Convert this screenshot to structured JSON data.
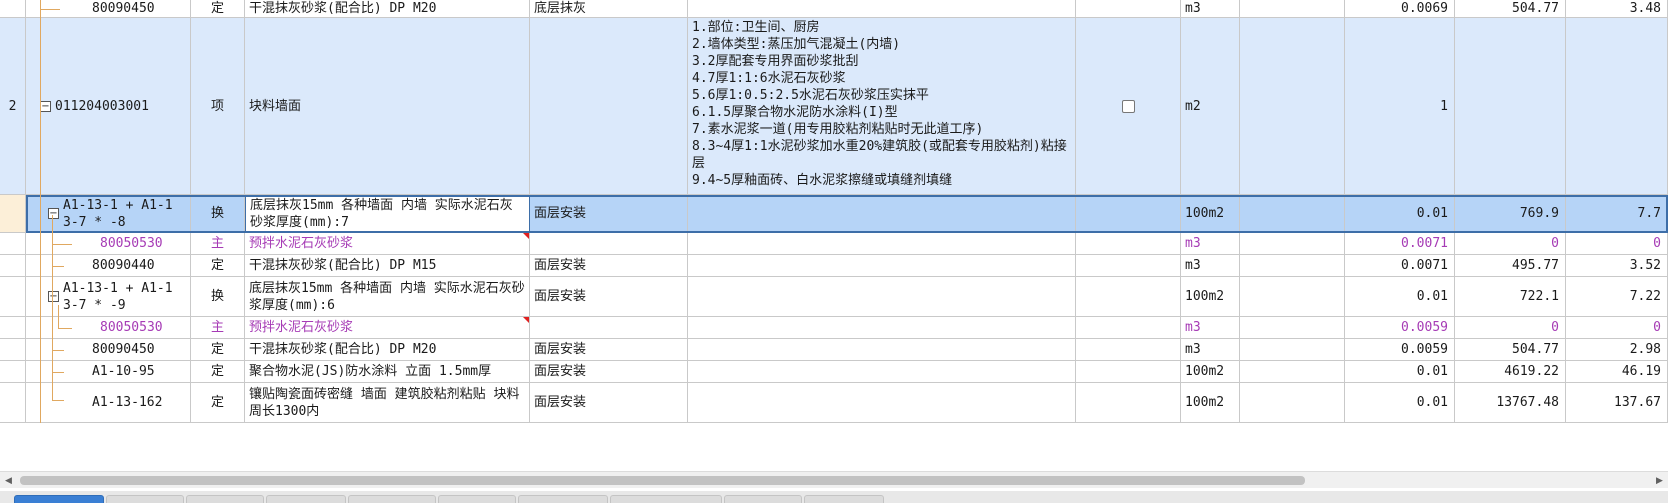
{
  "rows": [
    {
      "code": "80090450",
      "type": "定",
      "name": "干混抹灰砂浆(配合比) DP M20",
      "feature": "底层抹灰",
      "unit": "m3",
      "qty": "0.0069",
      "price": "504.77",
      "total": "3.48"
    },
    {
      "idx": "2",
      "code": "011204003001",
      "type": "项",
      "name": "块料墙面",
      "unit": "m2",
      "qty": "1",
      "desc": [
        "1.部位:卫生间、厨房",
        "2.墙体类型:蒸压加气混凝土(内墙)",
        "3.2厚配套专用界面砂浆批刮",
        "4.7厚1:1:6水泥石灰砂浆",
        "5.6厚1:0.5:2.5水泥石灰砂浆压实抹平",
        "6.1.5厚聚合物水泥防水涂料(I)型",
        "7.素水泥浆一道(用专用胶粘剂粘贴时无此道工序)",
        "8.3~4厚1:1水泥砂浆加水重20%建筑胶(或配套专用胶粘剂)粘接层",
        "9.4~5厚釉面砖、白水泥浆擦缝或填缝剂填缝"
      ]
    },
    {
      "code": "A1-13-1 + A1-13-7 * -8",
      "type": "换",
      "name": "底层抹灰15mm 各种墙面 内墙  实际水泥石灰砂浆厚度(mm):7",
      "feature": "面层安装",
      "unit": "100m2",
      "qty": "0.01",
      "price": "769.9",
      "total": "7.7"
    },
    {
      "code": "80050530",
      "type": "主",
      "name": "预拌水泥石灰砂浆",
      "feature": "",
      "unit": "m3",
      "qty": "0.0071",
      "price": "0",
      "total": "0"
    },
    {
      "code": "80090440",
      "type": "定",
      "name": "干混抹灰砂浆(配合比) DP M15",
      "feature": "面层安装",
      "unit": "m3",
      "qty": "0.0071",
      "price": "495.77",
      "total": "3.52"
    },
    {
      "code": "A1-13-1 + A1-13-7 * -9",
      "type": "换",
      "name": "底层抹灰15mm 各种墙面 内墙  实际水泥石灰砂浆厚度(mm):6",
      "feature": "面层安装",
      "unit": "100m2",
      "qty": "0.01",
      "price": "722.1",
      "total": "7.22"
    },
    {
      "code": "80050530",
      "type": "主",
      "name": "预拌水泥石灰砂浆",
      "feature": "",
      "unit": "m3",
      "qty": "0.0059",
      "price": "0",
      "total": "0"
    },
    {
      "code": "80090450",
      "type": "定",
      "name": "干混抹灰砂浆(配合比) DP M20",
      "feature": "面层安装",
      "unit": "m3",
      "qty": "0.0059",
      "price": "504.77",
      "total": "2.98"
    },
    {
      "code": "A1-10-95",
      "type": "定",
      "name": "聚合物水泥(JS)防水涂料 立面 1.5mm厚",
      "feature": "面层安装",
      "unit": "100m2",
      "qty": "0.01",
      "price": "4619.22",
      "total": "46.19"
    },
    {
      "code": "A1-13-162",
      "type": "定",
      "name": "镶贴陶瓷面砖密缝 墙面 建筑胶粘剂粘贴 块料周长1300内",
      "feature": "面层安装",
      "unit": "100m2",
      "qty": "0.01",
      "price": "13767.48",
      "total": "137.67"
    }
  ],
  "tree": {
    "expand_symbol": "−"
  },
  "colors": {
    "header_row": "#dbe9fb",
    "selected_row": "#b6d4f7",
    "main_material": "#a63bb5",
    "tree_line": "#e0a860"
  },
  "scrollbar": {
    "left_arrow": "◀",
    "right_arrow": "▶"
  }
}
